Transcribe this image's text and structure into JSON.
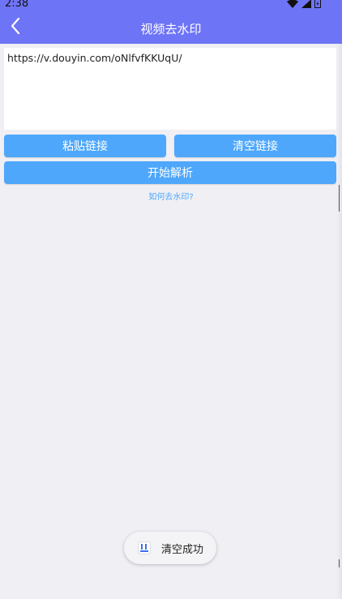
{
  "status_bar": {
    "time": "2:38"
  },
  "toolbar": {
    "title": "视频去水印",
    "back_icon": "chevron-left-icon"
  },
  "url_input": {
    "value": "https://v.douyin.com/oNlfvfKKUqU/",
    "placeholder": ""
  },
  "buttons": {
    "paste_label": "粘贴链接",
    "clear_label": "清空链接",
    "parse_label": "开始解析"
  },
  "help_link": "如何去水印?",
  "toast": {
    "message": "清空成功",
    "icon": "app-icon"
  },
  "colors": {
    "toolbar": "#6e74f6",
    "button": "#4ea7fb",
    "background": "#efeff4"
  }
}
